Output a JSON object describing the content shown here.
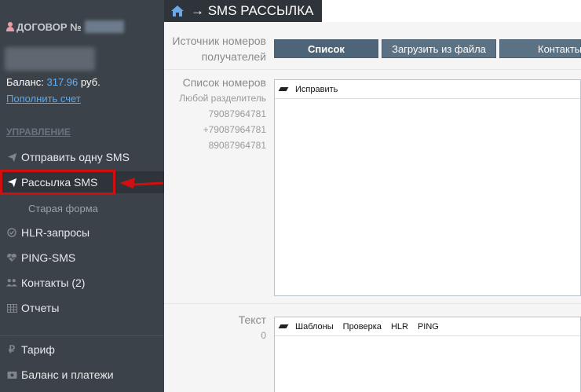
{
  "sidebar": {
    "contract_label": "ДОГОВОР №",
    "balance_label": "Баланс:",
    "balance_amount": "317.96",
    "balance_currency": "руб.",
    "topup_link": "Пополнить счет",
    "section_title": "УПРАВЛЕНИЕ",
    "items": [
      {
        "label": "Отправить одну SMS",
        "icon": "send-icon"
      },
      {
        "label": "Рассылка SMS",
        "icon": "send-icon",
        "active": true
      },
      {
        "label": "Старая форма"
      },
      {
        "label": "HLR-запросы",
        "icon": "check-circle-icon"
      },
      {
        "label": "PING-SMS",
        "icon": "heartbeat-icon"
      },
      {
        "label": "Контакты (2)",
        "icon": "users-icon"
      },
      {
        "label": "Отчеты",
        "icon": "table-icon"
      },
      {
        "label": "Тариф",
        "icon": "ruble-icon"
      },
      {
        "label": "Баланс и платежи",
        "icon": "wallet-icon"
      }
    ]
  },
  "header": {
    "title": "→ SMS РАССЫЛКА",
    "icon": "home-icon"
  },
  "form": {
    "source_label": "Источник номеров получателей",
    "source_buttons": [
      "Список",
      "Загрузить из файла",
      "Контакты"
    ],
    "list_label": "Список номеров",
    "list_hint": "Любой разделитель",
    "list_examples": [
      "79087964781",
      "+79087964781",
      "89087964781"
    ],
    "list_toolbar": [
      "Исправить"
    ],
    "text_label": "Текст",
    "text_count": "0",
    "text_toolbar": [
      "Шаблоны",
      "Проверка",
      "HLR",
      "PING"
    ]
  },
  "colors": {
    "sidebar_bg": "#3b4249",
    "active_bg": "#2e3439",
    "highlight": "#d01010",
    "button_bg": "#5b7184",
    "link": "#5aa8f0"
  }
}
